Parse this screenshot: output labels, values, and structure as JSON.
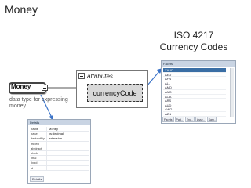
{
  "slide": {
    "title": "Money"
  },
  "iso": {
    "line1": "ISO 4217",
    "line2": "Currency Codes"
  },
  "diagram": {
    "attributes_label": "attributes",
    "attribute_name": "currencyCode",
    "element_name": "Money",
    "element_description": "data type for expressing money"
  },
  "facets": {
    "title": "Facets",
    "items": [
      "XAUD",
      "AED",
      "AFN",
      "ALL",
      "AMD",
      "ANG",
      "AOA",
      "ARS",
      "AUD",
      "AWG",
      "AZN"
    ],
    "tabs": [
      "Facets",
      "Patt..",
      "Enu..",
      "Asse..",
      "Sam.."
    ]
  },
  "details": {
    "title": "Details",
    "rows": [
      {
        "key": "name",
        "value": "Money"
      },
      {
        "key": "base",
        "value": "xs:decimal"
      },
      {
        "key": "derivedBy",
        "value": "extension"
      },
      {
        "key": "mixed",
        "value": ""
      },
      {
        "key": "abstract",
        "value": ""
      },
      {
        "key": "block",
        "value": ""
      },
      {
        "key": "final",
        "value": ""
      },
      {
        "key": "fixed",
        "value": ""
      },
      {
        "key": "id",
        "value": ""
      }
    ],
    "tab": "Details"
  }
}
